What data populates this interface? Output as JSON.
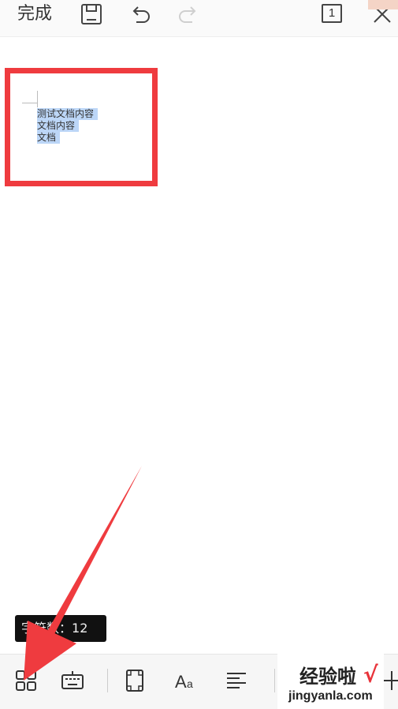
{
  "topbar": {
    "done_label": "完成",
    "save_icon": "save-icon",
    "undo_icon": "undo-icon",
    "redo_icon": "redo-icon",
    "page_count": "1",
    "close_icon": "close-icon"
  },
  "document": {
    "lines": [
      "测试文档内容",
      "文档内容",
      "文档"
    ],
    "selection_color": "#bcd6f7"
  },
  "annotation": {
    "rect_color": "#ef3b3f",
    "arrow_color": "#ef3b3f"
  },
  "wordcount": {
    "label": "字符数：",
    "value": "12"
  },
  "bottombar": {
    "items": [
      {
        "icon": "apps-grid-icon"
      },
      {
        "icon": "keyboard-icon"
      },
      {
        "icon": "page-frame-icon"
      },
      {
        "icon": "font-icon",
        "label": "Aa"
      },
      {
        "icon": "align-left-icon"
      },
      {
        "icon": "add-icon"
      }
    ]
  },
  "watermark": {
    "title": "经验啦",
    "check": "√",
    "url": "jingyanla.com"
  }
}
